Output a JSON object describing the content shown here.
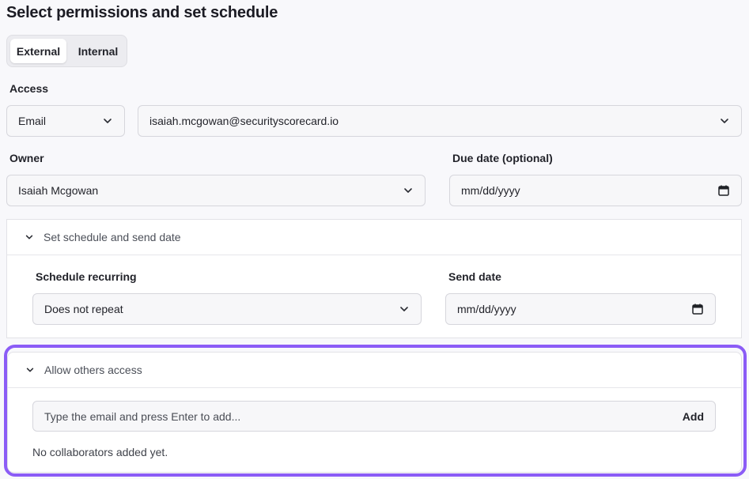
{
  "page": {
    "title": "Select permissions and set schedule"
  },
  "tabs": [
    {
      "label": "External",
      "active": true
    },
    {
      "label": "Internal",
      "active": false
    }
  ],
  "access": {
    "label": "Access",
    "type_value": "Email",
    "email_value": "isaiah.mcgowan@securityscorecard.io"
  },
  "owner": {
    "label": "Owner",
    "value": "Isaiah Mcgowan"
  },
  "due_date": {
    "label": "Due date (optional)",
    "placeholder": "mm/dd/yyyy"
  },
  "schedule": {
    "header": "Set schedule and send date",
    "recurring_label": "Schedule recurring",
    "recurring_value": "Does not repeat",
    "send_date_label": "Send date",
    "send_date_placeholder": "mm/dd/yyyy"
  },
  "others": {
    "header": "Allow others access",
    "input_placeholder": "Type the email and press Enter to add...",
    "add_label": "Add",
    "empty_text": "No collaborators added yet."
  },
  "colors": {
    "highlight": "#8b5cf6",
    "background": "#f8f8fb"
  }
}
